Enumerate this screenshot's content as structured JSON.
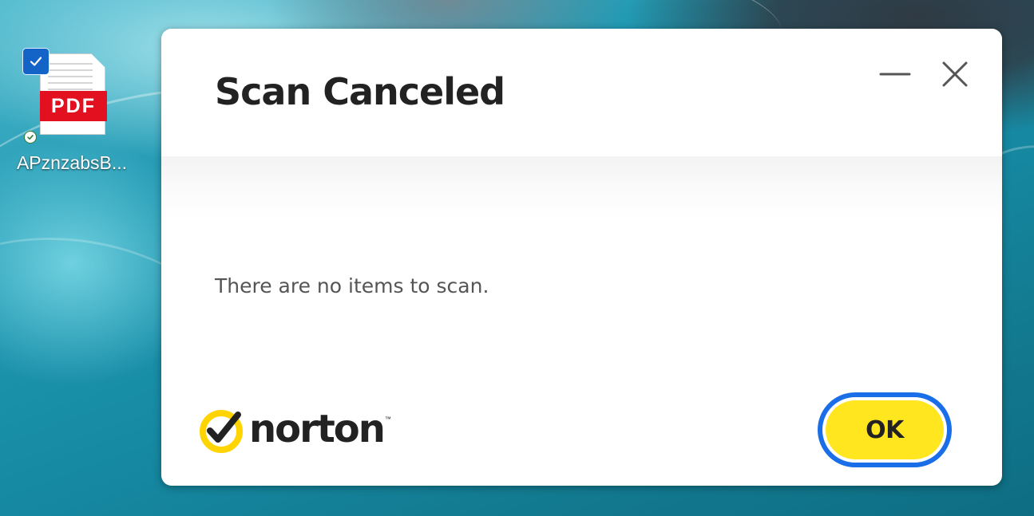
{
  "desktop": {
    "file": {
      "name": "APznzabsB...",
      "badge": "PDF",
      "selected": true,
      "sync_status": "available-offline"
    }
  },
  "dialog": {
    "title": "Scan Canceled",
    "message": "There are no items to scan.",
    "window_controls": {
      "minimize_icon": "minimize-icon",
      "close_icon": "close-icon"
    },
    "brand": {
      "name": "norton",
      "trademark": "™",
      "logo_icon": "norton-checkmark-icon"
    },
    "ok_label": "OK"
  },
  "colors": {
    "ok_fill": "#ffe61e",
    "ok_focus_ring": "#1a6fe8",
    "brand_yellow": "#ffd400",
    "pdf_red": "#e3101f",
    "selection_blue": "#1464c8"
  }
}
